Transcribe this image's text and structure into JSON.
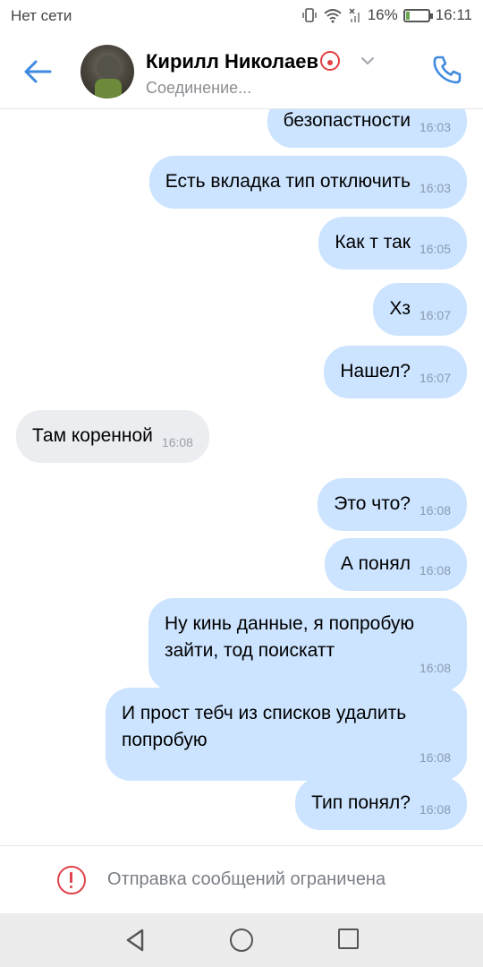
{
  "status_bar": {
    "carrier": "Нет сети",
    "battery_percent": "16%",
    "battery_level": 0.16,
    "time": "16:11",
    "icons": [
      "vibrate-icon",
      "wifi-icon",
      "no-signal-icon",
      "battery-icon"
    ]
  },
  "header": {
    "contact_name": "Кирилл Николаев",
    "status": "Соединение...",
    "back_icon": "arrow-left-icon",
    "call_icon": "phone-icon",
    "accent_color": "#3f8ae0"
  },
  "messages": [
    {
      "dir": "out",
      "text": "безопастности",
      "time": "16:03"
    },
    {
      "dir": "out",
      "text": "Есть вкладка тип отключить",
      "time": "16:03"
    },
    {
      "dir": "out",
      "text": "Как т так",
      "time": "16:05"
    },
    {
      "dir": "out",
      "text": "Хз",
      "time": "16:07"
    },
    {
      "dir": "out",
      "text": "Нашел?",
      "time": "16:07"
    },
    {
      "dir": "in",
      "text": "Там коренной",
      "time": "16:08"
    },
    {
      "dir": "out",
      "text": "Это что?",
      "time": "16:08"
    },
    {
      "dir": "out",
      "text": "А понял",
      "time": "16:08"
    },
    {
      "dir": "out",
      "text": "Ну кинь данные, я попробую зайти, тод поискатт",
      "time": "16:08"
    },
    {
      "dir": "out",
      "text": "И прост тебч из списков удалить попробую",
      "time": "16:08"
    },
    {
      "dir": "out",
      "text": "Тип понял?",
      "time": "16:08"
    }
  ],
  "restriction": {
    "text": "Отправка сообщений ограничена",
    "icon": "alert-circle-icon",
    "icon_color": "#e0434b"
  },
  "colors": {
    "outgoing_bubble": "#cce4ff",
    "incoming_bubble": "#ebedf0"
  },
  "nav_bar": {
    "icons": [
      "nav-back-icon",
      "nav-home-icon",
      "nav-recents-icon"
    ]
  }
}
